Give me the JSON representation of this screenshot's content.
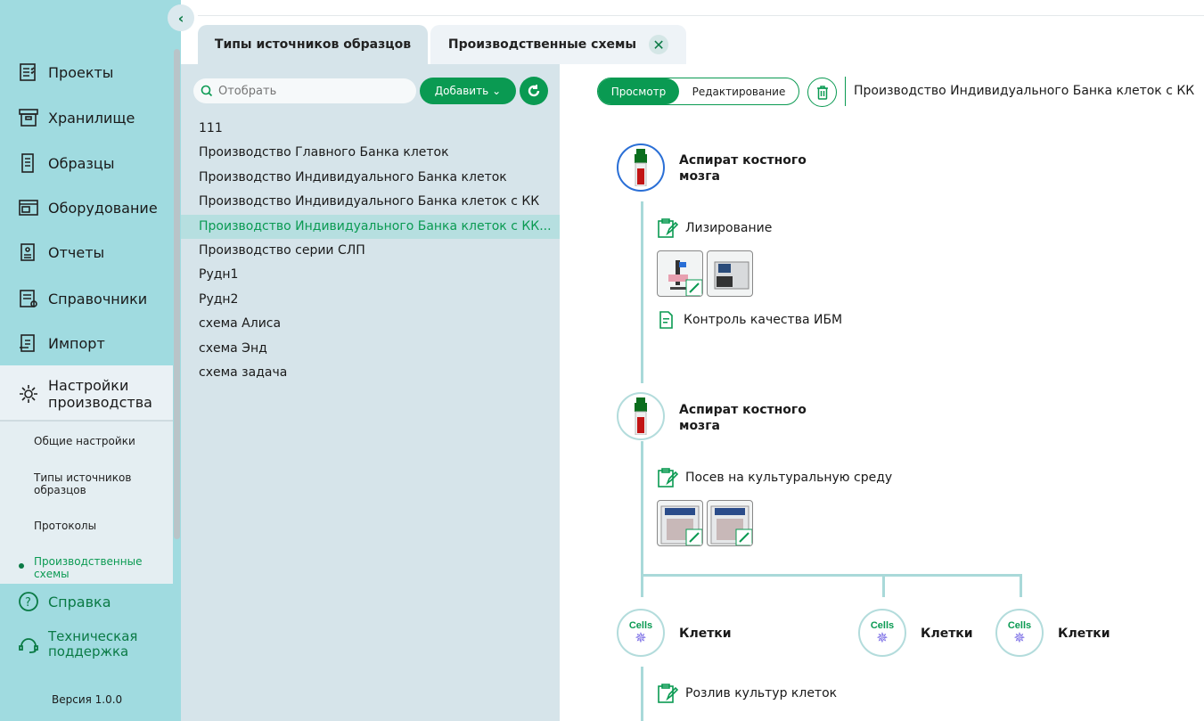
{
  "sidebar": {
    "items": [
      {
        "label": "Проекты",
        "icon": "projects-icon"
      },
      {
        "label": "Хранилище",
        "icon": "storage-icon"
      },
      {
        "label": "Образцы",
        "icon": "samples-icon"
      },
      {
        "label": "Оборудование",
        "icon": "equipment-icon"
      },
      {
        "label": "Отчеты",
        "icon": "reports-icon"
      },
      {
        "label": "Справочники",
        "icon": "reference-icon"
      },
      {
        "label": "Импорт",
        "icon": "import-icon"
      }
    ],
    "settings": {
      "label": "Настройки производства",
      "sub": [
        "Общие настройки",
        "Типы источников образцов",
        "Протоколы",
        "Производственные схемы"
      ],
      "active_sub": 3
    },
    "help": "Справка",
    "support": "Техническая поддержка",
    "version": "Версия 1.0.0"
  },
  "tabs": [
    {
      "label": "Типы источников образцов",
      "active": true
    },
    {
      "label": "Производственные схемы",
      "closable": true
    }
  ],
  "list": {
    "search_placeholder": "Отобрать",
    "add_label": "Добавить",
    "items": [
      "111",
      "Производство Главного Банка клеток",
      "Производство Индивидуального Банка клеток",
      "Производство Индивидуального Банка клеток с КК",
      "Производство Индивидуального Банка клеток с КК...",
      "Производство серии СЛП",
      "Рудн1",
      "Рудн2",
      "схема Алиса",
      "схема Энд",
      "схема задача"
    ],
    "selected": 4
  },
  "detail": {
    "mode_view": "Просмотр",
    "mode_edit": "Редактирование",
    "title": "Производство Индивидуального Банка клеток с КК",
    "flow": {
      "node1": "Аспират костного мозга",
      "step1": "Лизирование",
      "step1b": "Контроль качества ИБМ",
      "node2": "Аспират костного мозга",
      "step2": "Посев на культуральную среду",
      "cells_badge": "Cells",
      "cells": [
        "Клетки",
        "Клетки",
        "Клетки"
      ],
      "step3": "Розлив культур клеток"
    }
  },
  "colors": {
    "accent": "#0a9a52",
    "sidebar": "#a0dbe0",
    "panel": "#d6e4ea",
    "selected_row": "#b6dfe0",
    "connector": "#a9d9d9",
    "active_node": "#2a6fd6"
  }
}
